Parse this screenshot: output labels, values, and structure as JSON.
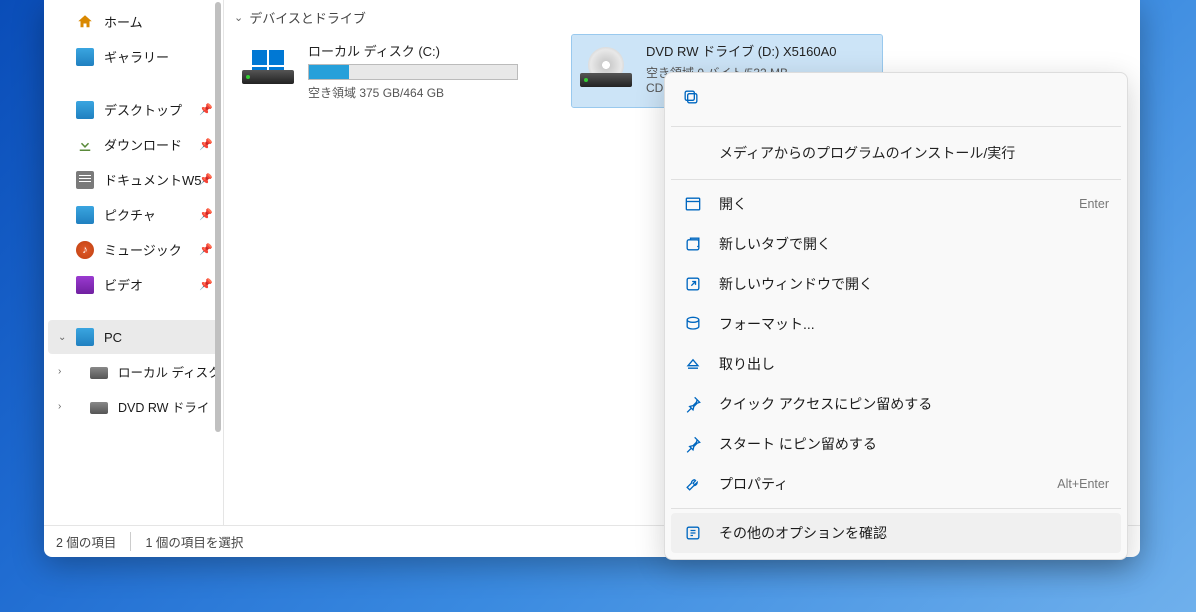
{
  "section_header": "デバイスとドライブ",
  "sidebar": {
    "home": "ホーム",
    "gallery": "ギャラリー",
    "desktop": "デスクトップ",
    "downloads": "ダウンロード",
    "documents": "ドキュメントW5",
    "pictures": "ピクチャ",
    "music": "ミュージック",
    "video": "ビデオ",
    "pc": "PC",
    "local_disk": "ローカル ディスク",
    "dvd_drive": "DVD RW ドライ"
  },
  "drives": {
    "c": {
      "name": "ローカル ディスク (C:)",
      "free": "空き領域 375 GB/464 GB",
      "fill_percent": 19
    },
    "d": {
      "name": "DVD RW ドライブ (D:) X5160A0",
      "free": "空き領域 0 バイト/532 MB",
      "sub": "CD"
    }
  },
  "status": {
    "count": "2 個の項目",
    "selected": "1 個の項目を選択"
  },
  "menu": {
    "install": "メディアからのプログラムのインストール/実行",
    "open": "開く",
    "open_accel": "Enter",
    "open_tab": "新しいタブで開く",
    "open_window": "新しいウィンドウで開く",
    "format": "フォーマット...",
    "eject": "取り出し",
    "pin_quick": "クイック アクセスにピン留めする",
    "pin_start": "スタート にピン留めする",
    "properties": "プロパティ",
    "properties_accel": "Alt+Enter",
    "more": "その他のオプションを確認"
  }
}
